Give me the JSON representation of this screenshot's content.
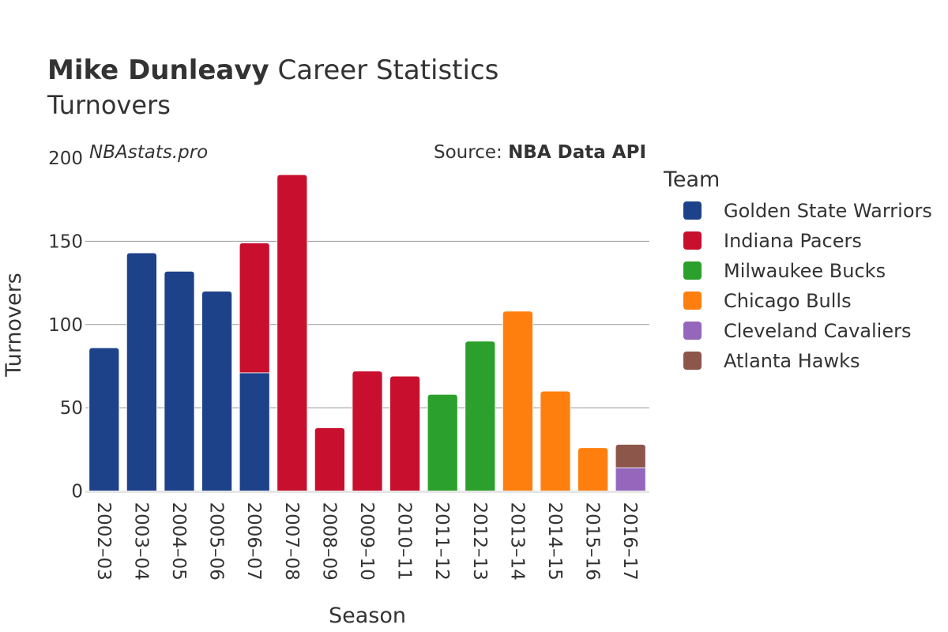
{
  "chart_data": {
    "type": "bar",
    "stacked": true,
    "title_bold": "Mike Dunleavy",
    "title_rest": " Career Statistics",
    "subtitle": "Turnovers",
    "watermark": "NBAstats.pro",
    "source_label": "Source: ",
    "source_name": "NBA Data API",
    "xlabel": "Season",
    "ylabel": "Turnovers",
    "ylim": [
      0,
      200
    ],
    "yticks": [
      0,
      50,
      100,
      150,
      200
    ],
    "grid": true,
    "legend_title": "Team",
    "legend_position": "right",
    "categories": [
      "2002–03",
      "2003–04",
      "2004–05",
      "2005–06",
      "2006–07",
      "2007–08",
      "2008–09",
      "2009–10",
      "2010–11",
      "2011–12",
      "2012–13",
      "2013–14",
      "2014–15",
      "2015–16",
      "2016–17"
    ],
    "series": [
      {
        "name": "Golden State Warriors",
        "color": "#1d428a",
        "values": [
          86,
          143,
          132,
          120,
          71,
          0,
          0,
          0,
          0,
          0,
          0,
          0,
          0,
          0,
          0
        ]
      },
      {
        "name": "Indiana Pacers",
        "color": "#c8102e",
        "values": [
          0,
          0,
          0,
          0,
          78,
          190,
          38,
          72,
          69,
          0,
          0,
          0,
          0,
          0,
          0
        ]
      },
      {
        "name": "Milwaukee Bucks",
        "color": "#2ca02c",
        "values": [
          0,
          0,
          0,
          0,
          0,
          0,
          0,
          0,
          0,
          58,
          90,
          0,
          0,
          0,
          0
        ]
      },
      {
        "name": "Chicago Bulls",
        "color": "#ff7f0e",
        "values": [
          0,
          0,
          0,
          0,
          0,
          0,
          0,
          0,
          0,
          0,
          0,
          108,
          60,
          26,
          0
        ]
      },
      {
        "name": "Cleveland Cavaliers",
        "color": "#9467bd",
        "values": [
          0,
          0,
          0,
          0,
          0,
          0,
          0,
          0,
          0,
          0,
          0,
          0,
          0,
          0,
          14
        ]
      },
      {
        "name": "Atlanta Hawks",
        "color": "#8c564b",
        "values": [
          0,
          0,
          0,
          0,
          0,
          0,
          0,
          0,
          0,
          0,
          0,
          0,
          0,
          0,
          14
        ]
      }
    ]
  }
}
